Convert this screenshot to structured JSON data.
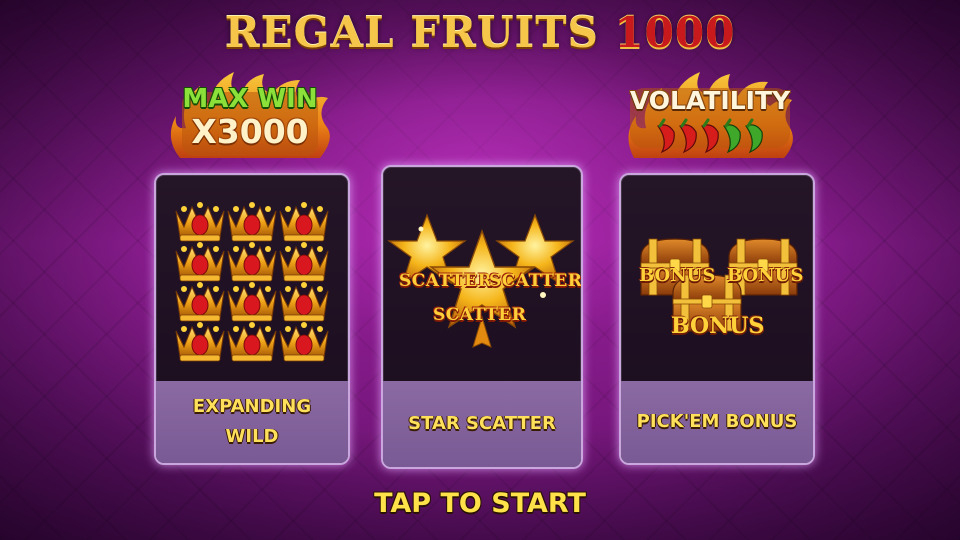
{
  "title": {
    "main": "REGAL FRUITS",
    "number": "1000"
  },
  "badges": {
    "max_win": {
      "line1": "MAX WIN",
      "line2": "X3000"
    },
    "volatility": {
      "label": "VOLATILITY",
      "icon": "chili-pepper-icon",
      "level_filled": 5,
      "level_total": 5
    }
  },
  "cards": [
    {
      "id": "expanding-wild",
      "label": "EXPANDING\nWILD",
      "icon": "crown-icon",
      "crown_grid": [
        3,
        4
      ]
    },
    {
      "id": "star-scatter",
      "label": "STAR SCATTER",
      "icon": "star-icon",
      "symbol_text": [
        "SCATTER",
        "SCATTER",
        "SCATTER"
      ]
    },
    {
      "id": "pickem-bonus",
      "label": "PICK'EM BONUS",
      "icon": "treasure-chest-icon",
      "symbol_text": [
        "BONUS",
        "BONUS",
        "BONUS"
      ]
    }
  ],
  "tap_to_start": "TAP TO START",
  "colors": {
    "gold": "#ffe24a",
    "background": "#8c1d92",
    "card_footer": "#8b6aa3",
    "accent_red": "#c8191d",
    "accent_green": "#8be03a"
  }
}
